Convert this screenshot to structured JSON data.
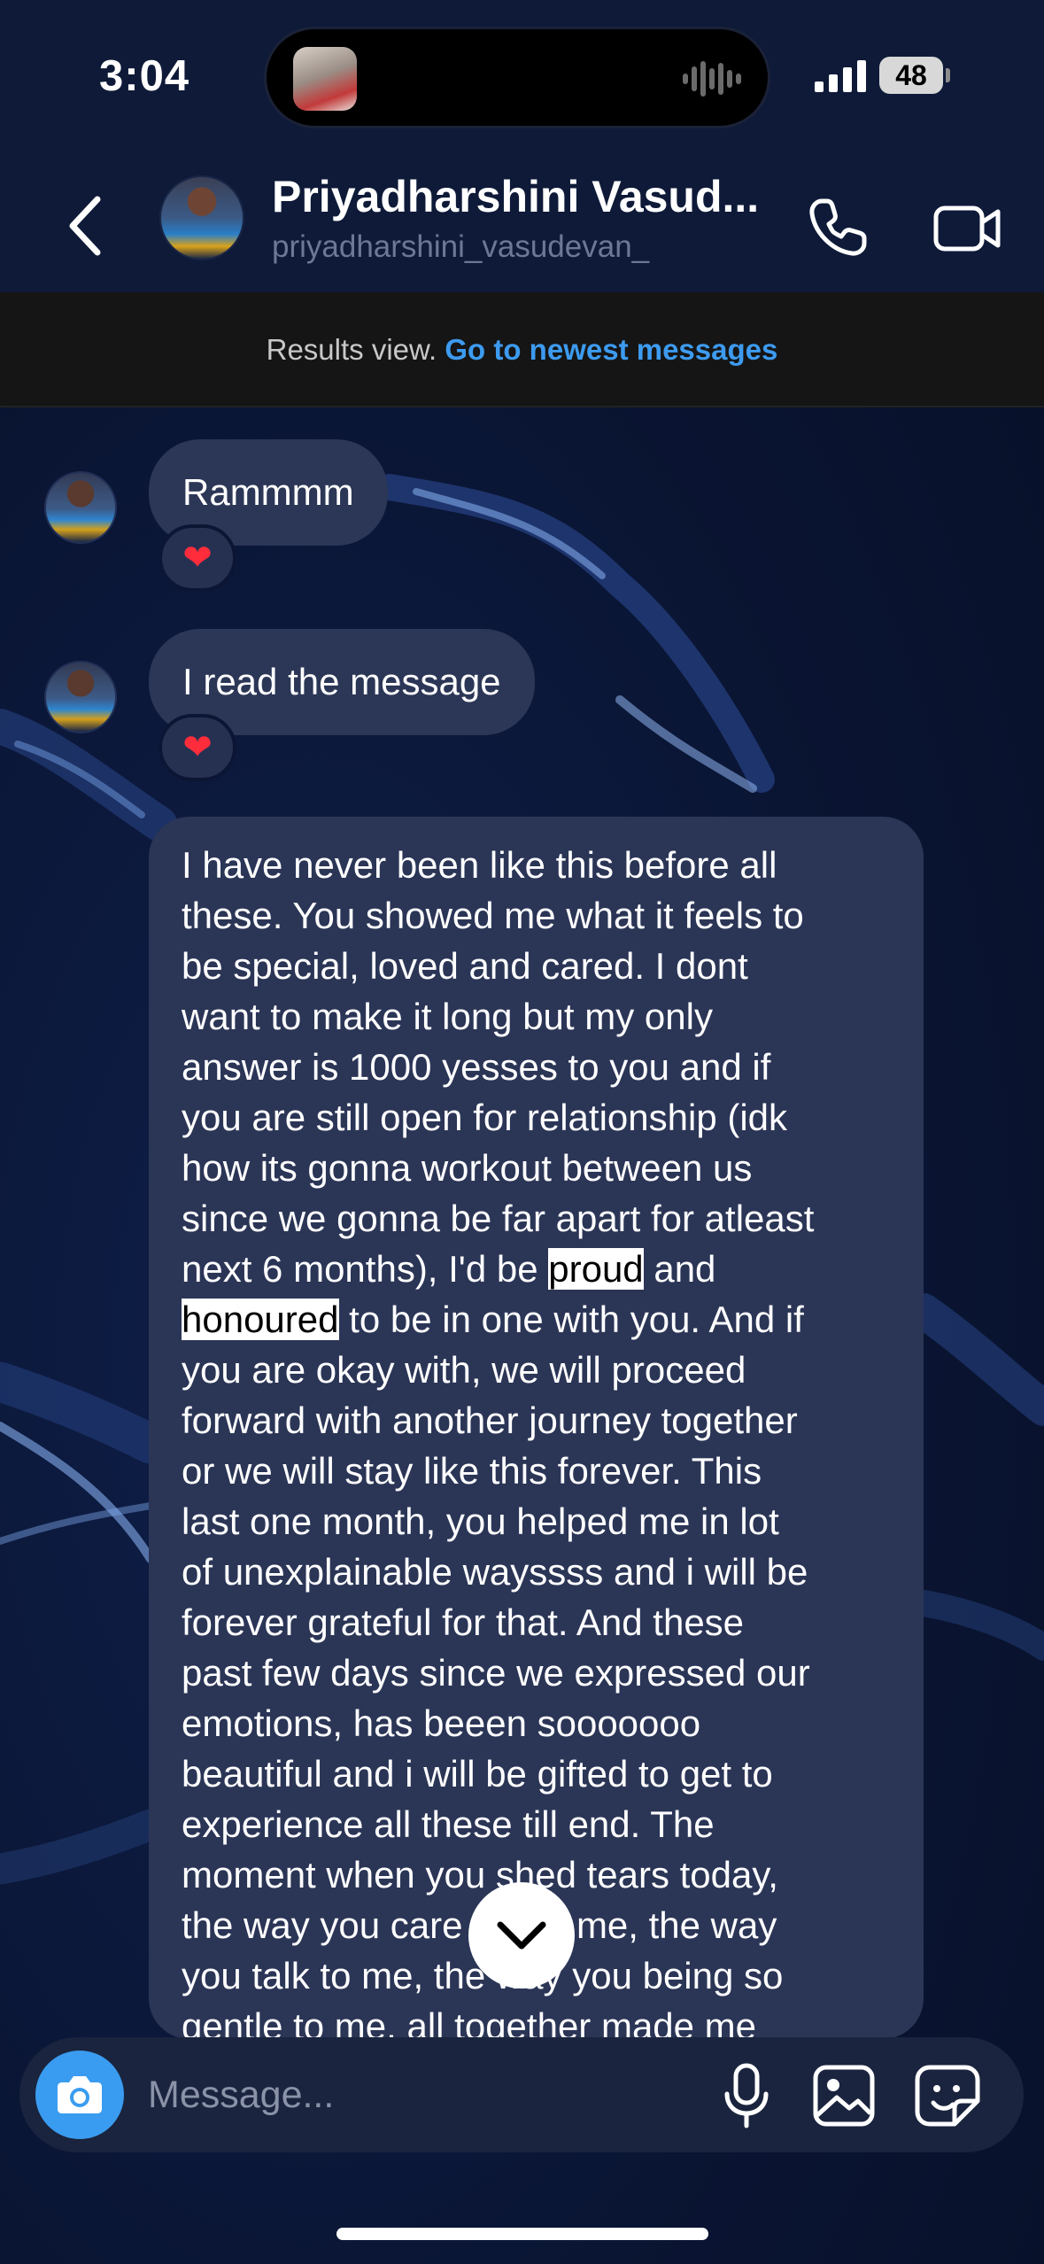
{
  "status_bar": {
    "time": "3:04",
    "battery": "48"
  },
  "header": {
    "contact_name": "Priyadharshini Vasud...",
    "contact_handle": "priyadharshini_vasudevan_"
  },
  "banner": {
    "text": "Results view. ",
    "link": "Go to newest messages"
  },
  "messages": [
    {
      "text": "Rammmm",
      "reaction": "❤"
    },
    {
      "text": "I read the message",
      "reaction": "❤"
    }
  ],
  "long_message": {
    "lines": [
      "I have never been like this before all",
      "these. You showed me what it feels to",
      "be special, loved and cared. I dont",
      "want to make it long but my only",
      "answer is 1000 yesses to you and if",
      "you are still open for relationship (idk",
      "how its gonna workout between us",
      "since we gonna be far apart for atleast"
    ],
    "line_9_before": "next 6 months), I'd be ",
    "highlight_1": "proud",
    "line_9_after": " and",
    "highlight_2": "honoured",
    "line_10_after": " to be in one with you. And if",
    "lines_rest": [
      "you are okay with, we will proceed",
      "forward with another journey together",
      "or we will stay like this forever. This",
      "last one month, you helped me in lot",
      "of unexplainable wayssss and i will be",
      "forever grateful for that. And these",
      "past few days since we expressed our",
      "emotions, has beeen sooooooo",
      "beautiful and i will be gifted to get to",
      "experience all these till end. The",
      "moment when you shed tears today,",
      "the way you care about me, the way",
      "you talk to me, the way you being so",
      "gentle to me, all together made me"
    ]
  },
  "composer": {
    "placeholder": "Message..."
  },
  "colors": {
    "accent": "#3d9bf0",
    "bubble": "#2c3656",
    "heart": "#ff2d3c"
  }
}
